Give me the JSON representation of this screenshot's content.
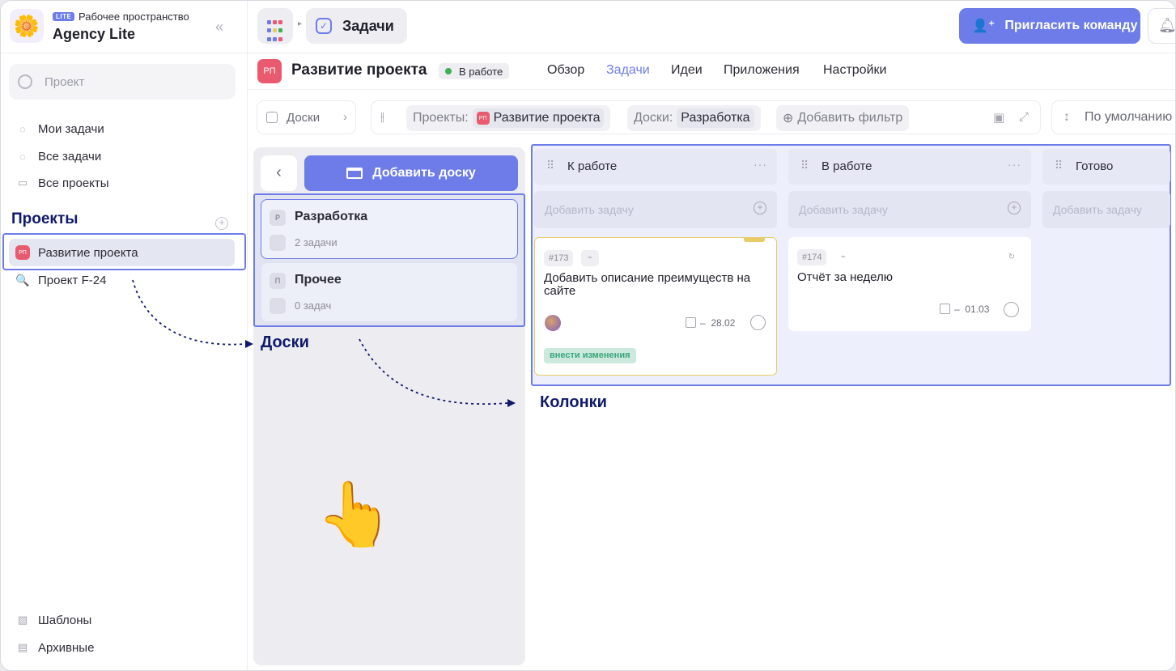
{
  "workspace": {
    "badge": "LITE",
    "subtitle": "Рабочее пространство",
    "name": "Agency Lite",
    "logo_icon": "flower-emoji-logo"
  },
  "sidebar": {
    "search_placeholder": "Проект",
    "nav": [
      {
        "label": "Мои задачи",
        "icon": "check-circle-icon"
      },
      {
        "label": "Все задачи",
        "icon": "check-circle-icon"
      },
      {
        "label": "Все проекты",
        "icon": "folder-icon"
      }
    ],
    "projects_heading": "Проекты",
    "projects": [
      {
        "label": "Развитие проекта",
        "icon_text": "РП",
        "selected": true
      },
      {
        "label": "Проект F-24",
        "icon": "magnifier-emoji-icon",
        "selected": false
      }
    ],
    "footer": [
      {
        "label": "Шаблоны",
        "icon": "templates-icon"
      },
      {
        "label": "Архивные",
        "icon": "archive-icon"
      }
    ]
  },
  "topbar": {
    "section": "Задачи",
    "invite_label": "Пригласить команду"
  },
  "project": {
    "icon_text": "РП",
    "title": "Развитие проекта",
    "status": "В работе",
    "status_color": "#3fae53",
    "tabs": [
      {
        "label": "Обзор",
        "active": false
      },
      {
        "label": "Задачи",
        "active": true
      },
      {
        "label": "Идеи",
        "active": false
      },
      {
        "label": "Приложения",
        "active": false
      },
      {
        "label": "Настройки",
        "active": false
      }
    ]
  },
  "filters": {
    "boards_button": "Доски",
    "projects_label": "Проекты:",
    "projects_value": "Развитие проекта",
    "projects_value_icon": "РП",
    "boards_label": "Доски:",
    "boards_value": "Разработка",
    "add_filter": "Добавить фильтр",
    "sort_label": "По умолчанию"
  },
  "boards_panel": {
    "add_board": "Добавить доску",
    "boards": [
      {
        "letter": "Р",
        "name": "Разработка",
        "count": "2 задачи",
        "selected": true
      },
      {
        "letter": "П",
        "name": "Прочее",
        "count": "0 задач",
        "selected": false
      }
    ]
  },
  "annotations": {
    "boards": "Доски",
    "columns": "Колонки"
  },
  "columns": [
    {
      "name": "К работе",
      "add_task": "Добавить задачу",
      "tasks": [
        {
          "id": "#173",
          "title_lines": [
            "Добавить описание преимуществ на",
            "сайте"
          ],
          "date": "28.02",
          "label": "внести изменения",
          "has_avatar": true,
          "highlighted": true
        }
      ]
    },
    {
      "name": "В работе",
      "add_task": "Добавить задачу",
      "tasks": [
        {
          "id": "#174",
          "title_lines": [
            "Отчёт за неделю"
          ],
          "date": "01.03",
          "has_avatar": false,
          "highlighted": false
        }
      ]
    },
    {
      "name": "Готово",
      "add_task": "Добавить задачу",
      "tasks": []
    }
  ],
  "accent_color": "#6d7ce8",
  "annotation_color": "#101a6b"
}
